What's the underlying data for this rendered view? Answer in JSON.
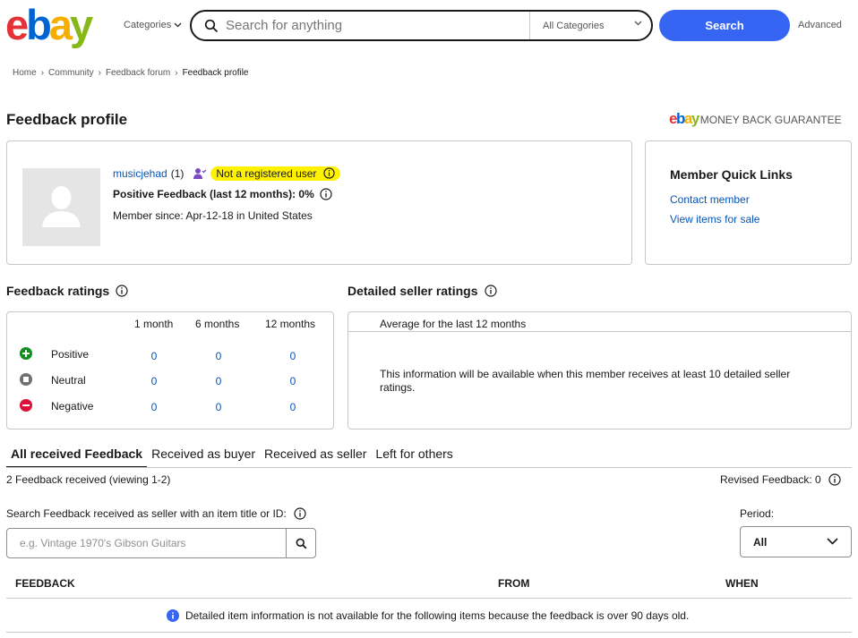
{
  "header": {
    "logo": {
      "e": "e",
      "b": "b",
      "a": "a",
      "y": "y"
    },
    "categories_label": "Categories",
    "search_placeholder": "Search for anything",
    "all_categories": "All Categories",
    "search_button": "Search",
    "advanced": "Advanced"
  },
  "breadcrumb": [
    "Home",
    "Community",
    "Feedback forum",
    "Feedback profile"
  ],
  "page_title": "Feedback profile",
  "mbg": {
    "logo": "ebay",
    "text": "MONEY BACK GUARANTEE"
  },
  "profile": {
    "username": "musicjehad",
    "score": "(1)",
    "registration_status": "Not a registered user",
    "positive_feedback": "Positive Feedback (last 12 months): 0%",
    "member_since": "Member since: Apr-12-18 in United States"
  },
  "quick_links": {
    "title": "Member Quick Links",
    "contact": "Contact member",
    "view_items": "View items for sale"
  },
  "feedback_ratings": {
    "title": "Feedback ratings",
    "columns": [
      "1 month",
      "6 months",
      "12 months"
    ],
    "rows": [
      {
        "label": "Positive",
        "values": [
          "0",
          "0",
          "0"
        ]
      },
      {
        "label": "Neutral",
        "values": [
          "0",
          "0",
          "0"
        ]
      },
      {
        "label": "Negative",
        "values": [
          "0",
          "0",
          "0"
        ]
      }
    ]
  },
  "detailed_ratings": {
    "title": "Detailed seller ratings",
    "average_label": "Average for the last 12 months",
    "message": "This information will be available when this member receives at least 10 detailed seller ratings."
  },
  "tabs": [
    "All received Feedback",
    "Received as buyer",
    "Received as seller",
    "Left for others"
  ],
  "feedback_count": "2 Feedback received (viewing 1-2)",
  "revised": "Revised Feedback: 0",
  "search_label": "Search Feedback received as seller with an item title or ID:",
  "search_placeholder": "e.g. Vintage 1970's Gibson Guitars",
  "period": {
    "label": "Period:",
    "selected": "All"
  },
  "table": {
    "col_feedback": "FEEDBACK",
    "col_from": "FROM",
    "col_when": "WHEN"
  },
  "notice": "Detailed item information is not available for the following items because the feedback is over 90 days old.",
  "colors": {
    "accent": "#3665f3",
    "link": "#0654ba",
    "highlight": "#fff200",
    "positive": "#118f1e",
    "neutral": "#707070",
    "negative": "#e0103a"
  }
}
